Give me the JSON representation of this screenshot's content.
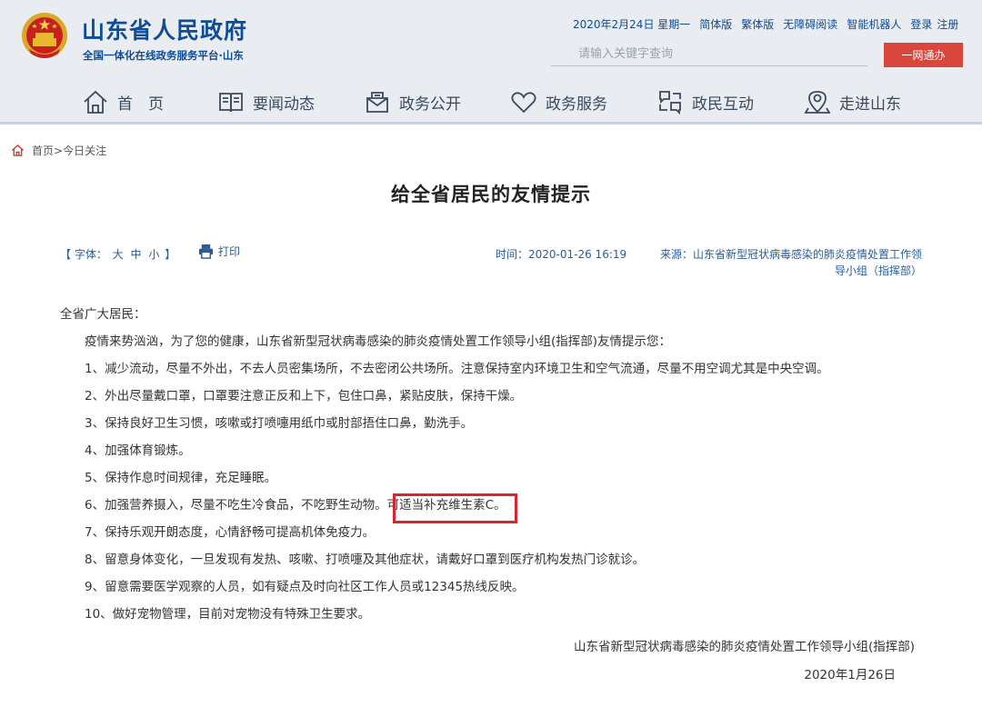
{
  "header": {
    "site_title": "山东省人民政府",
    "site_subtitle": "全国一体化在线政务服务平台·山东",
    "toplinks": {
      "date": "2020年2月24日 星期一",
      "simplified": "简体版",
      "traditional": "繁体版",
      "accessible": "无障碍阅读",
      "robot": "智能机器人",
      "login": "登录",
      "register": "注册"
    },
    "search": {
      "placeholder": "请输入关键字查询",
      "button_label": "一网通办"
    },
    "nav": [
      {
        "label": "首　页",
        "icon": "home-icon"
      },
      {
        "label": "要闻动态",
        "icon": "book-icon"
      },
      {
        "label": "政务公开",
        "icon": "mailbox-icon"
      },
      {
        "label": "政务服务",
        "icon": "heart-icon"
      },
      {
        "label": "政民互动",
        "icon": "chat-icon"
      },
      {
        "label": "走进山东",
        "icon": "location-icon"
      }
    ]
  },
  "breadcrumb": {
    "home": "首页",
    "separator": ">",
    "current": "今日关注"
  },
  "article": {
    "title": "给全省居民的友情提示",
    "font_label": "【 字体：",
    "font_big": "大",
    "font_mid": "中",
    "font_small": "小",
    "font_close": "】",
    "print_label": "打印",
    "time": "时间：2020-01-26 16:19",
    "source": "来源：山东省新型冠状病毒感染的肺炎疫情处置工作领导小组（指挥部）",
    "greeting": "全省广大居民：",
    "intro": "疫情来势汹汹，为了您的健康，山东省新型冠状病毒感染的肺炎疫情处置工作领导小组(指挥部)友情提示您：",
    "items": [
      "1、减少流动，尽量不外出，不去人员密集场所，不去密闭公共场所。注意保持室内环境卫生和空气流通，尽量不用空调尤其是中央空调。",
      "2、外出尽量戴口罩，口罩要注意正反和上下，包住口鼻，紧贴皮肤，保持干燥。",
      "3、保持良好卫生习惯，咳嗽或打喷嚏用纸巾或肘部捂住口鼻，勤洗手。",
      "4、加强体育锻炼。",
      "5、保持作息时间规律，充足睡眠。",
      "6、加强营养摄入，尽量不吃生冷食品，不吃野生动物。可适当补充维生素C。",
      "7、保持乐观开朗态度，心情舒畅可提高机体免疫力。",
      "8、留意身体变化，一旦发现有发热、咳嗽、打喷嚏及其他症状，请戴好口罩到医疗机构发热门诊就诊。",
      "9、留意需要医学观察的人员，如有疑点及时向社区工作人员或12345热线反映。",
      "10、做好宠物管理，目前对宠物没有特殊卫生要求。"
    ],
    "signature": "山东省新型冠状病毒感染的肺炎疫情处置工作领导小组(指挥部)",
    "signature_date": "2020年1月26日"
  },
  "colors": {
    "brand_blue": "#0e4c96",
    "search_button": "#d9463b",
    "highlight_box": "#d8262f"
  }
}
